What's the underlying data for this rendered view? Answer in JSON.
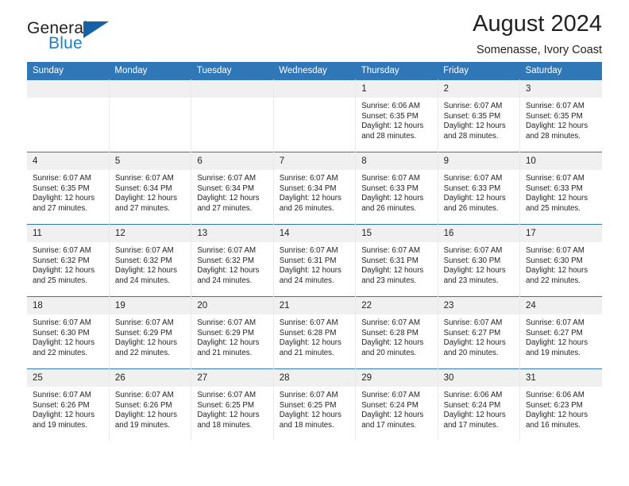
{
  "brand": {
    "name_part1": "General",
    "name_part2": "Blue",
    "flag_icon": "triangle-flag-icon",
    "accent_color": "#1c7fc4"
  },
  "header": {
    "title": "August 2024",
    "subtitle": "Somenasse, Ivory Coast"
  },
  "theme": {
    "header_bg": "#3077b8",
    "daynum_bg": "#f0f0f0",
    "text_color": "#231f20"
  },
  "weekdays": [
    "Sunday",
    "Monday",
    "Tuesday",
    "Wednesday",
    "Thursday",
    "Friday",
    "Saturday"
  ],
  "weeks": [
    [
      {
        "day": "",
        "empty": true,
        "sunrise": "",
        "sunset": "",
        "daylight1": "",
        "daylight2": ""
      },
      {
        "day": "",
        "empty": true,
        "sunrise": "",
        "sunset": "",
        "daylight1": "",
        "daylight2": ""
      },
      {
        "day": "",
        "empty": true,
        "sunrise": "",
        "sunset": "",
        "daylight1": "",
        "daylight2": ""
      },
      {
        "day": "",
        "empty": true,
        "sunrise": "",
        "sunset": "",
        "daylight1": "",
        "daylight2": ""
      },
      {
        "day": "1",
        "sunrise": "Sunrise: 6:06 AM",
        "sunset": "Sunset: 6:35 PM",
        "daylight1": "Daylight: 12 hours",
        "daylight2": "and 28 minutes."
      },
      {
        "day": "2",
        "sunrise": "Sunrise: 6:07 AM",
        "sunset": "Sunset: 6:35 PM",
        "daylight1": "Daylight: 12 hours",
        "daylight2": "and 28 minutes."
      },
      {
        "day": "3",
        "sunrise": "Sunrise: 6:07 AM",
        "sunset": "Sunset: 6:35 PM",
        "daylight1": "Daylight: 12 hours",
        "daylight2": "and 28 minutes."
      }
    ],
    [
      {
        "day": "4",
        "sunrise": "Sunrise: 6:07 AM",
        "sunset": "Sunset: 6:35 PM",
        "daylight1": "Daylight: 12 hours",
        "daylight2": "and 27 minutes."
      },
      {
        "day": "5",
        "sunrise": "Sunrise: 6:07 AM",
        "sunset": "Sunset: 6:34 PM",
        "daylight1": "Daylight: 12 hours",
        "daylight2": "and 27 minutes."
      },
      {
        "day": "6",
        "sunrise": "Sunrise: 6:07 AM",
        "sunset": "Sunset: 6:34 PM",
        "daylight1": "Daylight: 12 hours",
        "daylight2": "and 27 minutes."
      },
      {
        "day": "7",
        "sunrise": "Sunrise: 6:07 AM",
        "sunset": "Sunset: 6:34 PM",
        "daylight1": "Daylight: 12 hours",
        "daylight2": "and 26 minutes."
      },
      {
        "day": "8",
        "sunrise": "Sunrise: 6:07 AM",
        "sunset": "Sunset: 6:33 PM",
        "daylight1": "Daylight: 12 hours",
        "daylight2": "and 26 minutes."
      },
      {
        "day": "9",
        "sunrise": "Sunrise: 6:07 AM",
        "sunset": "Sunset: 6:33 PM",
        "daylight1": "Daylight: 12 hours",
        "daylight2": "and 26 minutes."
      },
      {
        "day": "10",
        "sunrise": "Sunrise: 6:07 AM",
        "sunset": "Sunset: 6:33 PM",
        "daylight1": "Daylight: 12 hours",
        "daylight2": "and 25 minutes."
      }
    ],
    [
      {
        "day": "11",
        "sunrise": "Sunrise: 6:07 AM",
        "sunset": "Sunset: 6:32 PM",
        "daylight1": "Daylight: 12 hours",
        "daylight2": "and 25 minutes."
      },
      {
        "day": "12",
        "sunrise": "Sunrise: 6:07 AM",
        "sunset": "Sunset: 6:32 PM",
        "daylight1": "Daylight: 12 hours",
        "daylight2": "and 24 minutes."
      },
      {
        "day": "13",
        "sunrise": "Sunrise: 6:07 AM",
        "sunset": "Sunset: 6:32 PM",
        "daylight1": "Daylight: 12 hours",
        "daylight2": "and 24 minutes."
      },
      {
        "day": "14",
        "sunrise": "Sunrise: 6:07 AM",
        "sunset": "Sunset: 6:31 PM",
        "daylight1": "Daylight: 12 hours",
        "daylight2": "and 24 minutes."
      },
      {
        "day": "15",
        "sunrise": "Sunrise: 6:07 AM",
        "sunset": "Sunset: 6:31 PM",
        "daylight1": "Daylight: 12 hours",
        "daylight2": "and 23 minutes."
      },
      {
        "day": "16",
        "sunrise": "Sunrise: 6:07 AM",
        "sunset": "Sunset: 6:30 PM",
        "daylight1": "Daylight: 12 hours",
        "daylight2": "and 23 minutes."
      },
      {
        "day": "17",
        "sunrise": "Sunrise: 6:07 AM",
        "sunset": "Sunset: 6:30 PM",
        "daylight1": "Daylight: 12 hours",
        "daylight2": "and 22 minutes."
      }
    ],
    [
      {
        "day": "18",
        "sunrise": "Sunrise: 6:07 AM",
        "sunset": "Sunset: 6:30 PM",
        "daylight1": "Daylight: 12 hours",
        "daylight2": "and 22 minutes."
      },
      {
        "day": "19",
        "sunrise": "Sunrise: 6:07 AM",
        "sunset": "Sunset: 6:29 PM",
        "daylight1": "Daylight: 12 hours",
        "daylight2": "and 22 minutes."
      },
      {
        "day": "20",
        "sunrise": "Sunrise: 6:07 AM",
        "sunset": "Sunset: 6:29 PM",
        "daylight1": "Daylight: 12 hours",
        "daylight2": "and 21 minutes."
      },
      {
        "day": "21",
        "sunrise": "Sunrise: 6:07 AM",
        "sunset": "Sunset: 6:28 PM",
        "daylight1": "Daylight: 12 hours",
        "daylight2": "and 21 minutes."
      },
      {
        "day": "22",
        "sunrise": "Sunrise: 6:07 AM",
        "sunset": "Sunset: 6:28 PM",
        "daylight1": "Daylight: 12 hours",
        "daylight2": "and 20 minutes."
      },
      {
        "day": "23",
        "sunrise": "Sunrise: 6:07 AM",
        "sunset": "Sunset: 6:27 PM",
        "daylight1": "Daylight: 12 hours",
        "daylight2": "and 20 minutes."
      },
      {
        "day": "24",
        "sunrise": "Sunrise: 6:07 AM",
        "sunset": "Sunset: 6:27 PM",
        "daylight1": "Daylight: 12 hours",
        "daylight2": "and 19 minutes."
      }
    ],
    [
      {
        "day": "25",
        "sunrise": "Sunrise: 6:07 AM",
        "sunset": "Sunset: 6:26 PM",
        "daylight1": "Daylight: 12 hours",
        "daylight2": "and 19 minutes."
      },
      {
        "day": "26",
        "sunrise": "Sunrise: 6:07 AM",
        "sunset": "Sunset: 6:26 PM",
        "daylight1": "Daylight: 12 hours",
        "daylight2": "and 19 minutes."
      },
      {
        "day": "27",
        "sunrise": "Sunrise: 6:07 AM",
        "sunset": "Sunset: 6:25 PM",
        "daylight1": "Daylight: 12 hours",
        "daylight2": "and 18 minutes."
      },
      {
        "day": "28",
        "sunrise": "Sunrise: 6:07 AM",
        "sunset": "Sunset: 6:25 PM",
        "daylight1": "Daylight: 12 hours",
        "daylight2": "and 18 minutes."
      },
      {
        "day": "29",
        "sunrise": "Sunrise: 6:07 AM",
        "sunset": "Sunset: 6:24 PM",
        "daylight1": "Daylight: 12 hours",
        "daylight2": "and 17 minutes."
      },
      {
        "day": "30",
        "sunrise": "Sunrise: 6:06 AM",
        "sunset": "Sunset: 6:24 PM",
        "daylight1": "Daylight: 12 hours",
        "daylight2": "and 17 minutes."
      },
      {
        "day": "31",
        "sunrise": "Sunrise: 6:06 AM",
        "sunset": "Sunset: 6:23 PM",
        "daylight1": "Daylight: 12 hours",
        "daylight2": "and 16 minutes."
      }
    ]
  ]
}
